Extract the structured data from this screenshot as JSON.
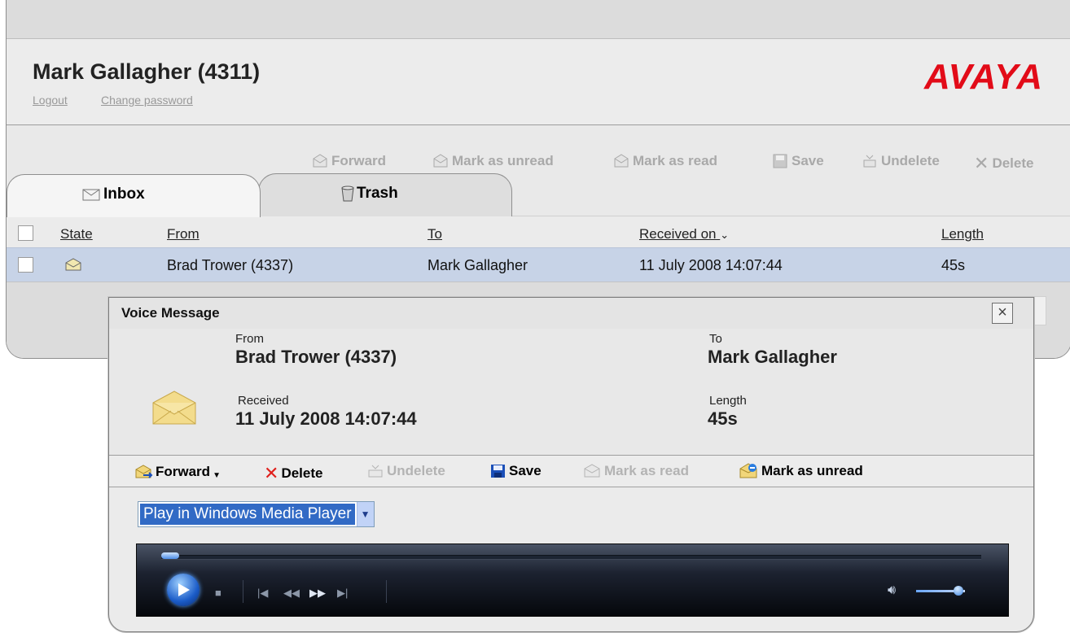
{
  "header": {
    "user_name": "Mark Gallagher (4311)",
    "logout": "Logout",
    "change_password": "Change password",
    "logo_text": "AVAYA",
    "logo_color": "#e20b18"
  },
  "toolbar": {
    "forward": "Forward",
    "mark_unread": "Mark as unread",
    "mark_read": "Mark as read",
    "save": "Save",
    "undelete": "Undelete",
    "delete": "Delete"
  },
  "tabs": [
    {
      "label": "Inbox",
      "icon": "envelope-icon"
    },
    {
      "label": "Trash",
      "icon": "trash-icon"
    }
  ],
  "list": {
    "columns": [
      "State",
      "From",
      "To",
      "Received on",
      "Length"
    ],
    "rows": [
      {
        "state_icon": "envelope-icon",
        "from": "Brad Trower (4337)",
        "to": "Mark Gallagher",
        "received": "11 July 2008 14:07:44",
        "length": "45s"
      }
    ]
  },
  "popup": {
    "title": "Voice Message",
    "close": "×",
    "from_label": "From",
    "from_value": "Brad Trower (4337)",
    "to_label": "To",
    "to_value": "Mark Gallagher",
    "received_label": "Received",
    "received_value": "11 July 2008 14:07:44",
    "length_label": "Length",
    "length_value": "45s",
    "toolbar": {
      "forward": "Forward",
      "delete": "Delete",
      "undelete": "Undelete",
      "save": "Save",
      "mark_read": "Mark as read",
      "mark_unread": "Mark as unread"
    },
    "player_select": "Play in Windows Media Player",
    "media_player": {
      "seek_position": 0,
      "volume_level": 0.75
    }
  },
  "colors": {
    "selected_row": "#c7d3e7",
    "disabled_text": "#a9a9a9",
    "delete_red": "#e0201c",
    "save_blue": "#1b4fb8"
  }
}
